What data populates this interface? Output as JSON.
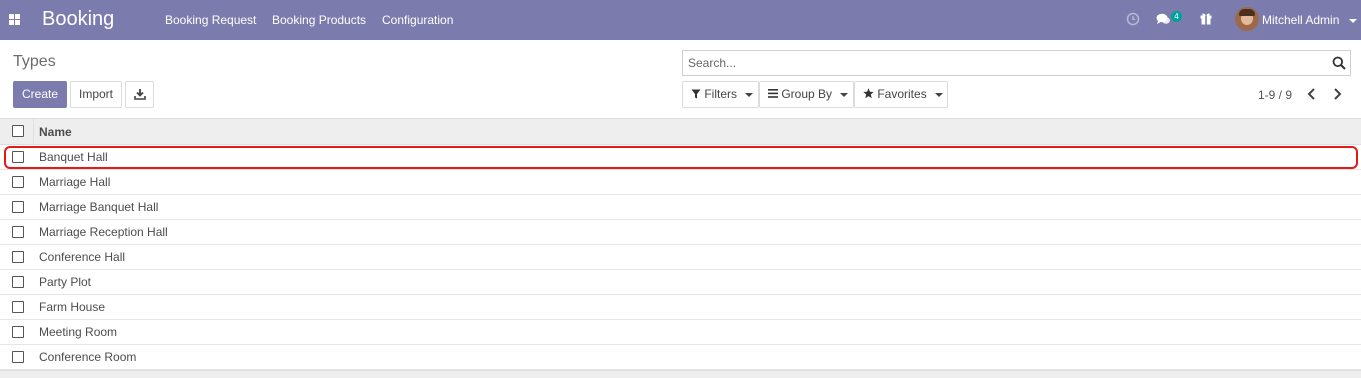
{
  "navbar": {
    "brand": "Booking",
    "menus": [
      "Booking Request",
      "Booking Products",
      "Configuration"
    ],
    "message_count": "4",
    "user_name": "Mitchell Admin",
    "icons": [
      "apps-grid-icon",
      "clock-icon",
      "chat-icon",
      "gift-icon",
      "user-avatar"
    ]
  },
  "page": {
    "title": "Types"
  },
  "buttons": {
    "create": "Create",
    "import": "Import",
    "download_icon": "download-icon"
  },
  "search": {
    "placeholder": "Search...",
    "value": ""
  },
  "filters": {
    "filters_label": "Filters",
    "group_by_label": "Group By",
    "favorites_label": "Favorites"
  },
  "pager": {
    "value": "1-9 / 9"
  },
  "list": {
    "columns": [
      "Name"
    ],
    "rows": [
      "Banquet Hall",
      "Marriage Hall",
      "Marriage Banquet Hall",
      "Marriage Reception Hall",
      "Conference Hall",
      "Party Plot",
      "Farm House",
      "Meeting Room",
      "Conference Room"
    ],
    "highlighted_row": "Banquet Hall"
  },
  "colors": {
    "brand": "#7c7bad",
    "badge": "#00a09d",
    "highlight_border": "#e41a1a",
    "header_bg": "#eeeeee"
  }
}
